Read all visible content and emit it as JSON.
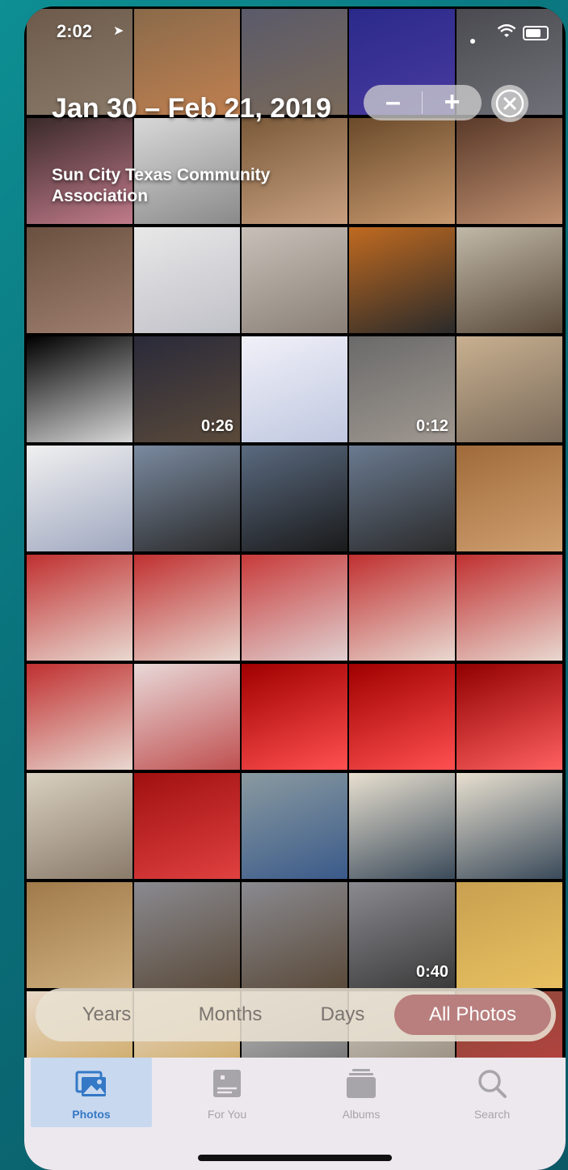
{
  "status_bar": {
    "time": "2:02"
  },
  "header": {
    "date_range": "Jan 30 – Feb 21, 2019",
    "location": "Sun City Texas Community Association"
  },
  "zoom_controls": {
    "zoom_out": "–",
    "zoom_in": "+"
  },
  "photo_grid": {
    "tiles": [
      {
        "c1": "#6d5a4a",
        "c2": "#8a7a6a"
      },
      {
        "c1": "#8a6a4a",
        "c2": "#c08050"
      },
      {
        "c1": "#5a5a6a",
        "c2": "#7a6a5a"
      },
      {
        "c1": "#2a2a8a",
        "c2": "#4a3aa0"
      },
      {
        "c1": "#4a4a50",
        "c2": "#707078"
      },
      {
        "c1": "#3a2a2a",
        "c2": "#c07a8a"
      },
      {
        "c1": "#d8d8d8",
        "c2": "#8a8a8a"
      },
      {
        "c1": "#7a5a3a",
        "c2": "#c8a080"
      },
      {
        "c1": "#6a4a2a",
        "c2": "#c89a70"
      },
      {
        "c1": "#5a3a2a",
        "c2": "#c09070"
      },
      {
        "c1": "#6a5040",
        "c2": "#a08070"
      },
      {
        "c1": "#e8e8e8",
        "c2": "#c0c0c8"
      },
      {
        "c1": "#c8c0b8",
        "c2": "#8a8078"
      },
      {
        "c1": "#c06a20",
        "c2": "#2a2a2a"
      },
      {
        "c1": "#c0b8a8",
        "c2": "#5a4a3a"
      },
      {
        "c1": "#000000",
        "c2": "#d8d8d8"
      },
      {
        "c1": "#2a2a3a",
        "c2": "#5a4a3a",
        "dur": "0:26"
      },
      {
        "c1": "#f0f0f8",
        "c2": "#c0c8e0"
      },
      {
        "c1": "#6a6a6a",
        "c2": "#a09890",
        "dur": "0:12"
      },
      {
        "c1": "#c8b090",
        "c2": "#7a6a5a"
      },
      {
        "c1": "#f0f0f0",
        "c2": "#a0a8c0"
      },
      {
        "c1": "#7a8aa0",
        "c2": "#2a2a2a"
      },
      {
        "c1": "#5a6a80",
        "c2": "#1a1a1a"
      },
      {
        "c1": "#6a7a90",
        "c2": "#2a2a2a"
      },
      {
        "c1": "#a06a3a",
        "c2": "#d0a070"
      },
      {
        "c1": "#c03030",
        "c2": "#e8d8d0"
      },
      {
        "c1": "#c03030",
        "c2": "#e8d8d0"
      },
      {
        "c1": "#c83a3a",
        "c2": "#e0d0d0"
      },
      {
        "c1": "#c03030",
        "c2": "#e8d8d0"
      },
      {
        "c1": "#c03030",
        "c2": "#e8d8d0"
      },
      {
        "c1": "#c03030",
        "c2": "#e8d8d0"
      },
      {
        "c1": "#e8d8d8",
        "c2": "#c05050"
      },
      {
        "c1": "#a00000",
        "c2": "#ff5050"
      },
      {
        "c1": "#a00000",
        "c2": "#ff5050"
      },
      {
        "c1": "#900000",
        "c2": "#ff6060"
      },
      {
        "c1": "#d8d0c0",
        "c2": "#8a7a6a"
      },
      {
        "c1": "#a01010",
        "c2": "#e04040"
      },
      {
        "c1": "#8a9aa0",
        "c2": "#3a5a8a"
      },
      {
        "c1": "#e8e0d0",
        "c2": "#3a4a5a"
      },
      {
        "c1": "#e8e0d0",
        "c2": "#3a4a5a"
      },
      {
        "c1": "#a07a4a",
        "c2": "#d0b080"
      },
      {
        "c1": "#8a8a90",
        "c2": "#5a4a3a"
      },
      {
        "c1": "#8a8a90",
        "c2": "#5a4a3a"
      },
      {
        "c1": "#8a8a90",
        "c2": "#3a3a3a",
        "dur": "0:40"
      },
      {
        "c1": "#c8a050",
        "c2": "#e8c060"
      },
      {
        "c1": "#e8d8c8",
        "c2": "#c8a050"
      },
      {
        "c1": "#e8d8c8",
        "c2": "#c8a050"
      },
      {
        "c1": "#c0c0c0",
        "c2": "#606060"
      },
      {
        "c1": "#d0c8c0",
        "c2": "#8a8070"
      },
      {
        "c1": "#8a4a3a",
        "c2": "#c04040"
      },
      {
        "c1": "#c8b8a8",
        "c2": "#8a7a6a"
      },
      {
        "c1": "#2a2aa0",
        "c2": "#4a3ac0"
      },
      {
        "c1": "#2a2aa0",
        "c2": "#4a3ac0"
      },
      {
        "c1": "#4a2a8a",
        "c2": "#6a4ab0"
      },
      {
        "c1": "#3a2a90",
        "c2": "#5a3ab0"
      }
    ]
  },
  "segment_control": {
    "years": "Years",
    "months": "Months",
    "days": "Days",
    "all_photos": "All Photos"
  },
  "tab_bar": {
    "photos": "Photos",
    "for_you": "For You",
    "albums": "Albums",
    "search": "Search"
  },
  "colors": {
    "accent": "#3478c6",
    "active_segment": "#b87f7e"
  }
}
